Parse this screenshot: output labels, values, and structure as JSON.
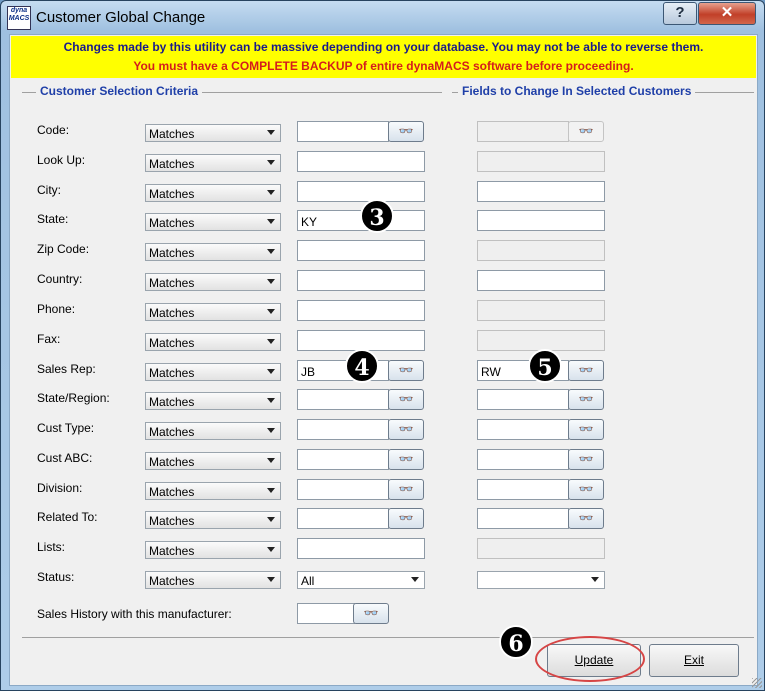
{
  "window": {
    "title": "Customer Global Change",
    "icon_text": "dyna MACS",
    "help_label": "?",
    "close_label": "✕"
  },
  "warning": {
    "line1": "Changes made by this utility can be massive depending on your database. You may not be able to reverse them.",
    "line2": "You must have a COMPLETE BACKUP of entire dynaMACS software before proceeding."
  },
  "sections": {
    "criteria_title": "Customer Selection Criteria",
    "fields_title": "Fields to Change In Selected Customers"
  },
  "rows": [
    {
      "label": "Code:",
      "operator": "Matches",
      "value": "",
      "lookup": true,
      "new_value": "",
      "new_enabled": false,
      "new_lookup": true,
      "new_lookup_enabled": false
    },
    {
      "label": "Look Up:",
      "operator": "Matches",
      "value": "",
      "lookup": false,
      "new_value": "",
      "new_enabled": false,
      "new_lookup": false
    },
    {
      "label": "City:",
      "operator": "Matches",
      "value": "",
      "lookup": false,
      "new_value": "",
      "new_enabled": true,
      "new_lookup": false
    },
    {
      "label": "State:",
      "operator": "Matches",
      "value": "KY",
      "lookup": false,
      "new_value": "",
      "new_enabled": true,
      "new_lookup": false
    },
    {
      "label": "Zip Code:",
      "operator": "Matches",
      "value": "",
      "lookup": false,
      "new_value": "",
      "new_enabled": false,
      "new_lookup": false
    },
    {
      "label": "Country:",
      "operator": "Matches",
      "value": "",
      "lookup": false,
      "new_value": "",
      "new_enabled": true,
      "new_lookup": false
    },
    {
      "label": "Phone:",
      "operator": "Matches",
      "value": "",
      "lookup": false,
      "new_value": "",
      "new_enabled": false,
      "new_lookup": false
    },
    {
      "label": "Fax:",
      "operator": "Matches",
      "value": "",
      "lookup": false,
      "new_value": "",
      "new_enabled": false,
      "new_lookup": false
    },
    {
      "label": "Sales Rep:",
      "operator": "Matches",
      "value": "JB",
      "lookup": true,
      "new_value": "RW",
      "new_enabled": true,
      "new_lookup": true,
      "new_lookup_enabled": true
    },
    {
      "label": "State/Region:",
      "operator": "Matches",
      "value": "",
      "lookup": true,
      "new_value": "",
      "new_enabled": true,
      "new_lookup": true,
      "new_lookup_enabled": true
    },
    {
      "label": "Cust Type:",
      "operator": "Matches",
      "value": "",
      "lookup": true,
      "new_value": "",
      "new_enabled": true,
      "new_lookup": true,
      "new_lookup_enabled": true
    },
    {
      "label": "Cust ABC:",
      "operator": "Matches",
      "value": "",
      "lookup": true,
      "new_value": "",
      "new_enabled": true,
      "new_lookup": true,
      "new_lookup_enabled": true
    },
    {
      "label": "Division:",
      "operator": "Matches",
      "value": "",
      "lookup": true,
      "new_value": "",
      "new_enabled": true,
      "new_lookup": true,
      "new_lookup_enabled": true
    },
    {
      "label": "Related To:",
      "operator": "Matches",
      "value": "",
      "lookup": true,
      "new_value": "",
      "new_enabled": true,
      "new_lookup": true,
      "new_lookup_enabled": true
    },
    {
      "label": "Lists:",
      "operator": "Matches",
      "value": "",
      "lookup": false,
      "new_value": "",
      "new_enabled": false,
      "new_lookup": false
    },
    {
      "label": "Status:",
      "operator": "Matches",
      "value": "All",
      "value_is_select": true,
      "lookup": false,
      "new_value": "",
      "new_enabled": true,
      "new_is_select": true,
      "new_lookup": false
    }
  ],
  "sales_history": {
    "label": "Sales History with this manufacturer:",
    "value": ""
  },
  "lookup_icon": "binoculars-icon",
  "lookup_glyph": "👓",
  "callouts": {
    "c3": "3",
    "c4": "4",
    "c5": "5",
    "c6": "6"
  },
  "buttons": {
    "update_label": "Update",
    "exit_label": "Exit"
  },
  "colors": {
    "warning_bg": "#ffff00",
    "warning_line1": "#1a1a8c",
    "warning_line2": "#d41d1d",
    "section_title": "#1f3fa8",
    "highlight_ring": "#d64545"
  }
}
